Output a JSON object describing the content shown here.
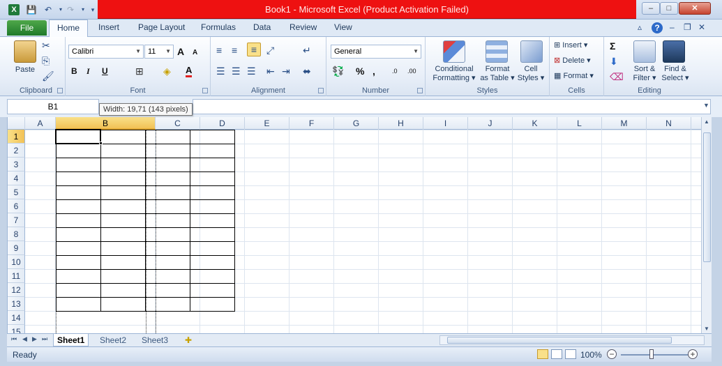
{
  "window": {
    "title": "Book1  -  Microsoft Excel (Product Activation Failed)",
    "title_bar_color": "#ee1111",
    "minimize": "–",
    "maximize": "□",
    "close": "✕"
  },
  "qat": {
    "app_icon": "X",
    "save": "💾",
    "undo": "↶",
    "redo": "↷",
    "customize": "▾"
  },
  "ribbon_tabs": {
    "file": "File",
    "home": "Home",
    "insert": "Insert",
    "page_layout": "Page Layout",
    "formulas": "Formulas",
    "data": "Data",
    "review": "Review",
    "view": "View",
    "help": "?"
  },
  "clipboard": {
    "paste": "Paste",
    "label": "Clipboard"
  },
  "font": {
    "name": "Calibri",
    "size": "11",
    "bold": "B",
    "italic": "I",
    "underline": "U",
    "grow": "A",
    "shrink": "A",
    "font_color_letter": "A",
    "label": "Font"
  },
  "alignment": {
    "label": "Alignment"
  },
  "number": {
    "format": "General",
    "percent": "%",
    "comma": ",",
    "inc_decimal": ".00",
    "dec_decimal": ".0",
    "label": "Number"
  },
  "styles": {
    "conditional_1": "Conditional",
    "conditional_2": "Formatting ▾",
    "format_table_1": "Format",
    "format_table_2": "as Table ▾",
    "cell_styles_1": "Cell",
    "cell_styles_2": "Styles ▾",
    "label": "Styles"
  },
  "cells": {
    "insert": "Insert ▾",
    "delete": "Delete ▾",
    "format": "Format ▾",
    "label": "Cells"
  },
  "editing": {
    "sigma": "Σ",
    "sort_1": "Sort &",
    "sort_2": "Filter ▾",
    "find_1": "Find &",
    "find_2": "Select ▾",
    "label": "Editing"
  },
  "formula_bar": {
    "name_box": "B1",
    "tooltip": "Width: 19,71 (143 pixels)"
  },
  "columns": [
    "A",
    "B",
    "C",
    "D",
    "E",
    "F",
    "G",
    "H",
    "I",
    "J",
    "K",
    "L",
    "M",
    "N"
  ],
  "rows": [
    "1",
    "2",
    "3",
    "4",
    "5",
    "6",
    "7",
    "8",
    "9",
    "10",
    "11",
    "12",
    "13",
    "14",
    "15"
  ],
  "selected": {
    "column": "B",
    "row": "1"
  },
  "sheet_tabs": [
    "Sheet1",
    "Sheet2",
    "Sheet3"
  ],
  "sheet_nav": {
    "first": "⏮",
    "prev": "◀",
    "next": "▶",
    "last": "⏭",
    "new_sheet": "✚"
  },
  "status": {
    "text": "Ready",
    "zoom": "100%",
    "zoom_minus": "−",
    "zoom_plus": "+"
  },
  "colors": {
    "accent": "#2a4f86",
    "selection": "#f2c256",
    "file_tab": "#1f7a2a"
  }
}
